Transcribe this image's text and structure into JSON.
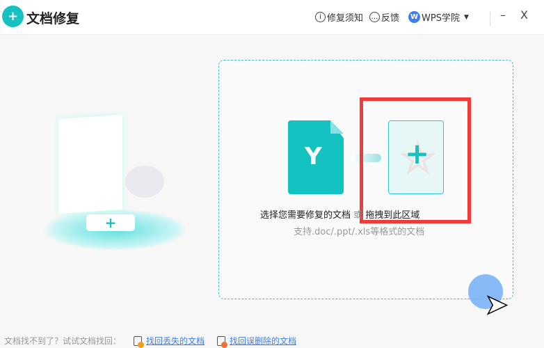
{
  "header": {
    "title": "文档修复",
    "logo_icon": "file-repair-icon",
    "notice": "修复须知",
    "feedback": "反馈",
    "academy": "WPS学院",
    "minimize": "–",
    "close": "X"
  },
  "dropzone": {
    "select_text": "选择您需要修复的文档",
    "or": "或",
    "drag_text": "拖拽到此区域",
    "support": "支持.doc/.ppt/.xls等格式的文档",
    "add_symbol": "+"
  },
  "footer": {
    "prompt": "文档找不到了？试试文档找回：",
    "link1": "找回丢失的文档",
    "link2": "找回误删除的文档"
  },
  "colors": {
    "accent": "#15c2c2",
    "highlight": "#f23a3a",
    "link": "#3b7ff0"
  }
}
